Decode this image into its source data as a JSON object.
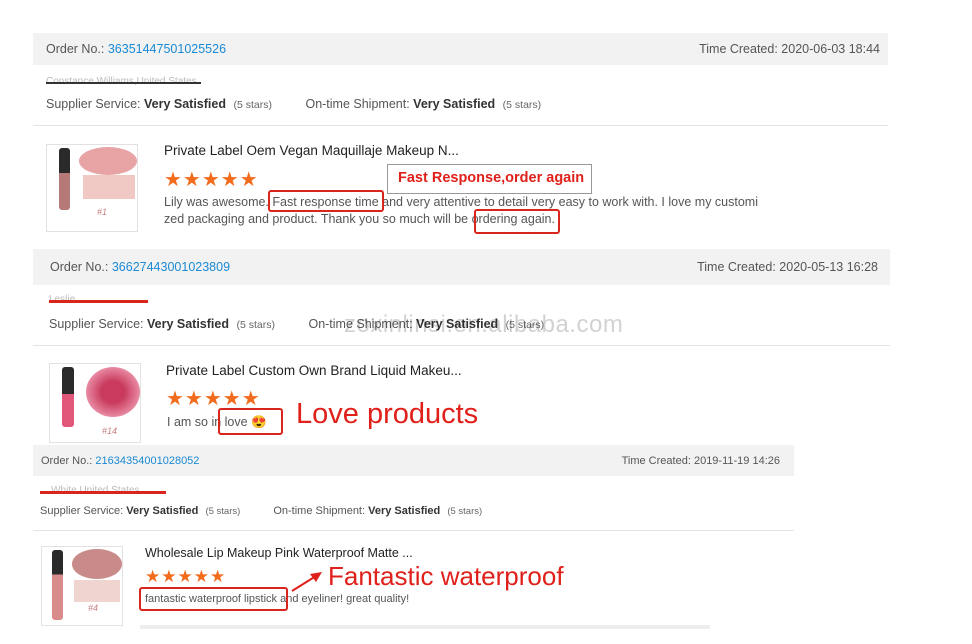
{
  "orders": [
    {
      "order_label": "Order No.:",
      "order_number": "36351447501025526",
      "time_label": "Time Created:",
      "time_value": "2020-06-03 18:44",
      "buyer": "Constance Williams,United States",
      "supplier_label": "Supplier Service:",
      "supplier_value": "Very Satisfied",
      "supplier_stars": "(5 stars)",
      "shipment_label": "On-time Shipment:",
      "shipment_value": "Very Satisfied",
      "shipment_stars": "(5 stars)",
      "product_title": "Private Label Oem Vegan Maquillaje Makeup N...",
      "rating": "★★★★★",
      "thumb_tag": "#1",
      "review_line1": "Lily was awesome. Fast response time and very attentive to detail very easy to work with. I love my customi",
      "review_line2": "zed packaging and product. Thank you so much will be ordering again.",
      "callout": "Fast Response,order again"
    },
    {
      "order_label": "Order No.:",
      "order_number": "36627443001023809",
      "time_label": "Time Created:",
      "time_value": "2020-05-13 16:28",
      "buyer": "Leslie ...",
      "supplier_label": "Supplier Service:",
      "supplier_value": "Very Satisfied",
      "supplier_stars": "(5 stars)",
      "shipment_label": "On-time Shipment:",
      "shipment_value": "Very Satisfied",
      "shipment_stars": "(5 stars)",
      "product_title": "Private Label Custom Own Brand Liquid Makeu...",
      "rating": "★★★★★",
      "thumb_tag": "#14",
      "review_text": "I am so in love 😍",
      "callout": "Love products"
    },
    {
      "order_label": "Order No.:",
      "order_number": "21634354001028052",
      "time_label": "Time Created:",
      "time_value": "2019-11-19 14:26",
      "buyer": "... White,United States",
      "supplier_label": "Supplier Service:",
      "supplier_value": "Very Satisfied",
      "supplier_stars": "(5 stars)",
      "shipment_label": "On-time Shipment:",
      "shipment_value": "Very Satisfied",
      "shipment_stars": "(5 stars)",
      "product_title": "Wholesale Lip Makeup Pink Waterproof Matte ...",
      "rating": "★★★★★",
      "thumb_tag": "#4",
      "review_text": "fantastic waterproof lipstick and eyeliner! great quality!",
      "callout": "Fantastic waterproof"
    }
  ],
  "watermark": "zoxinlinsi.en.alibaba.com",
  "colors": {
    "link": "#1a8ad4",
    "star": "#f36b1c",
    "highlight": "#d9251c"
  }
}
